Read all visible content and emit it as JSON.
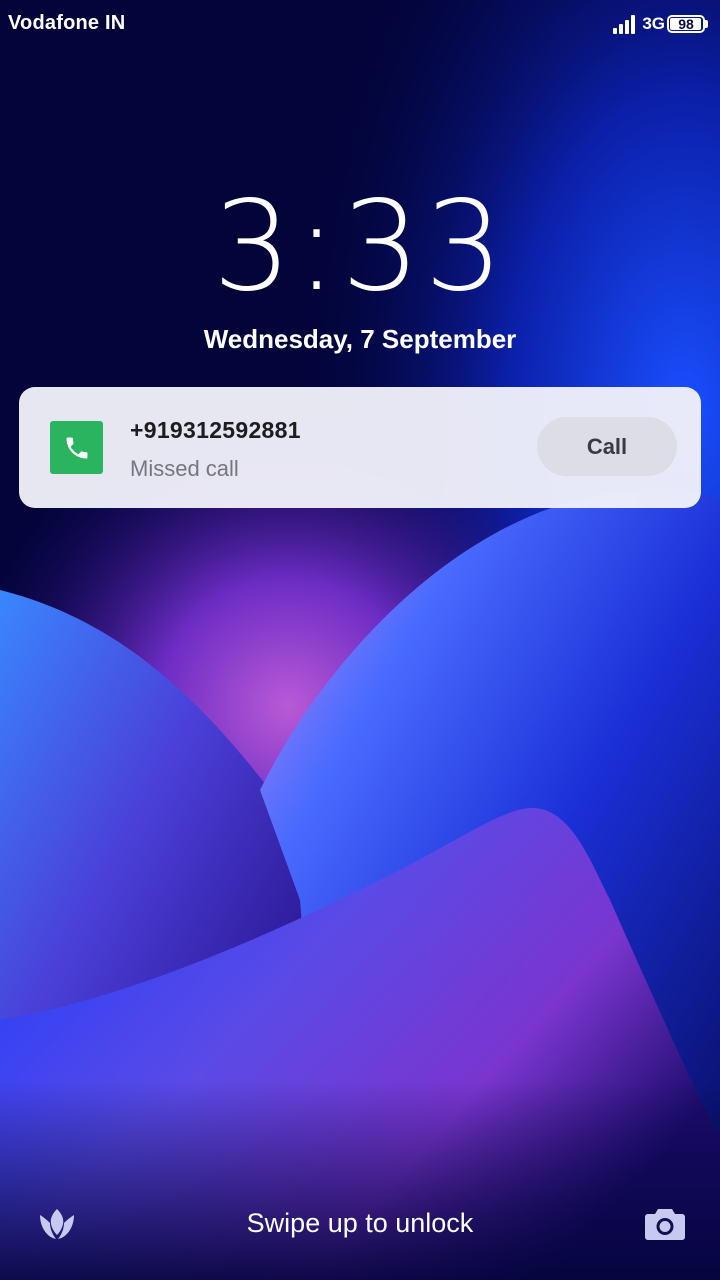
{
  "status_bar": {
    "carrier": "Vodafone IN",
    "network": "3G",
    "battery_level": "98",
    "signal_bars": 4,
    "signal_icon": "signal-icon",
    "battery_icon": "battery-icon"
  },
  "lock_screen": {
    "time": "3:33",
    "date": "Wednesday, 7 September",
    "unlock_hint": "Swipe up to unlock",
    "left_shortcut_icon": "tulip-logo-icon",
    "right_shortcut_icon": "camera-icon"
  },
  "notification": {
    "app_icon": "phone-icon",
    "title": "+919312592881",
    "subtitle": "Missed call",
    "action_label": "Call",
    "app_color": "#2ab460"
  },
  "colors": {
    "background_dark": "#03043a",
    "accent_blue": "#1a4fff",
    "accent_purple": "#9b4fe0"
  }
}
